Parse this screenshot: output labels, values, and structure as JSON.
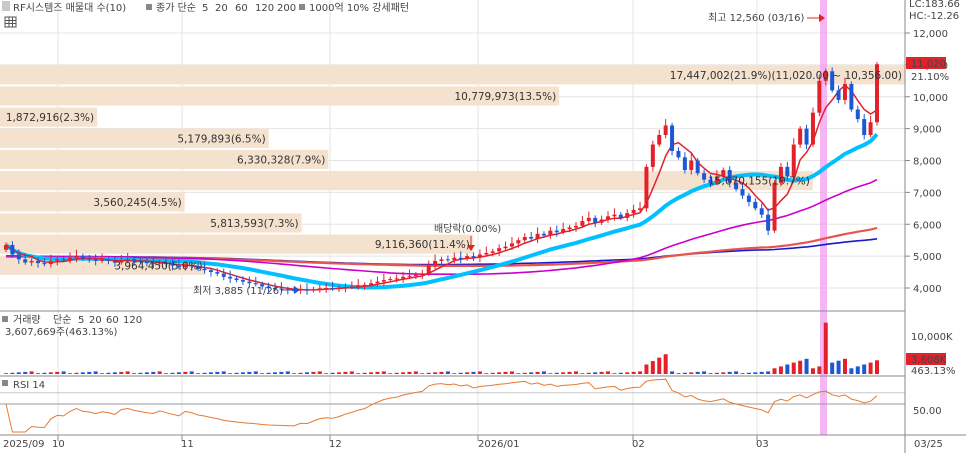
{
  "header": {
    "title": "RF시스템즈 매물대 수(10)",
    "ma_label": "종가 단순",
    "ma_periods": [
      {
        "label": "5",
        "color": "#e4202a"
      },
      {
        "label": "20",
        "color": "#00c0ff"
      },
      {
        "label": "60",
        "color": "#cc00cc"
      },
      {
        "label": "120",
        "color": "#e8554e"
      },
      {
        "label": "200",
        "color": "#1a1acc"
      }
    ],
    "extra": "1000억 10% 강세패턴"
  },
  "price_panel": {
    "right_scale": {
      "lc": "LC:183.66",
      "hc": "HC:-12.26",
      "ticks": [
        "12,000",
        "11,000",
        "10,000",
        "9,000",
        "8,000",
        "7,000",
        "6,000",
        "5,000",
        "4,000"
      ],
      "current_price": "11,020",
      "current_change": "21.10%"
    },
    "annotations": {
      "high": "최고 12,560 (03/16)",
      "low": "최저 3,885 (11/26)",
      "dividend": "배당락(0.00%)"
    },
    "volume_profile": [
      {
        "label": "17,447,002(21.9%)(11,020.00 ~ 10,356.00)",
        "value": 17447002,
        "price_low": 10356,
        "price_high": 11020
      },
      {
        "label": "10,779,973(13.5%)",
        "value": 10779973,
        "price_low": 9692,
        "price_high": 10356
      },
      {
        "label": "1,872,916(2.3%)",
        "value": 1872916,
        "price_low": 9028,
        "price_high": 9692
      },
      {
        "label": "5,179,893(6.5%)",
        "value": 5179893,
        "price_low": 8364,
        "price_high": 9028
      },
      {
        "label": "6,330,328(7.9%)",
        "value": 6330328,
        "price_low": 7700,
        "price_high": 8364
      },
      {
        "label": "15,670,155(19.7%)",
        "value": 15670155,
        "price_low": 7036,
        "price_high": 7700
      },
      {
        "label": "3,560,245(4.5%)",
        "value": 3560245,
        "price_low": 6372,
        "price_high": 7036
      },
      {
        "label": "5,813,593(7.3%)",
        "value": 5813593,
        "price_low": 5708,
        "price_high": 6372
      },
      {
        "label": "9,116,360(11.4%)",
        "value": 9116360,
        "price_low": 5044,
        "price_high": 5708
      },
      {
        "label": "3,964,450(5.0%)",
        "value": 3964450,
        "price_low": 4380,
        "price_high": 5044
      }
    ]
  },
  "volume_panel": {
    "title": "거래량",
    "ma_label": "단순",
    "ma_periods": [
      {
        "label": "5",
        "color": "#e4202a"
      },
      {
        "label": "20",
        "color": "#e8a020"
      },
      {
        "label": "60",
        "color": "#2aa02a"
      },
      {
        "label": "120",
        "color": "#888888"
      }
    ],
    "value": "3,607,669주(463.13%)",
    "right_ticks": [
      "10,000K"
    ],
    "current": "3,608K",
    "current_pct": "463.13%"
  },
  "rsi_panel": {
    "title": "RSI 14",
    "right_ticks": [
      "50.00"
    ]
  },
  "x_axis": [
    "2025/09",
    "10",
    "11",
    "12",
    "2026/01",
    "02",
    "03",
    "03/25"
  ],
  "colors": {
    "up": "#e4202a",
    "down": "#1c58d6",
    "highlight": "#f39cf0",
    "profile_fill": "#f4e2cf",
    "grid": "#e4e4e4",
    "rsi_line": "#e87a30"
  }
}
